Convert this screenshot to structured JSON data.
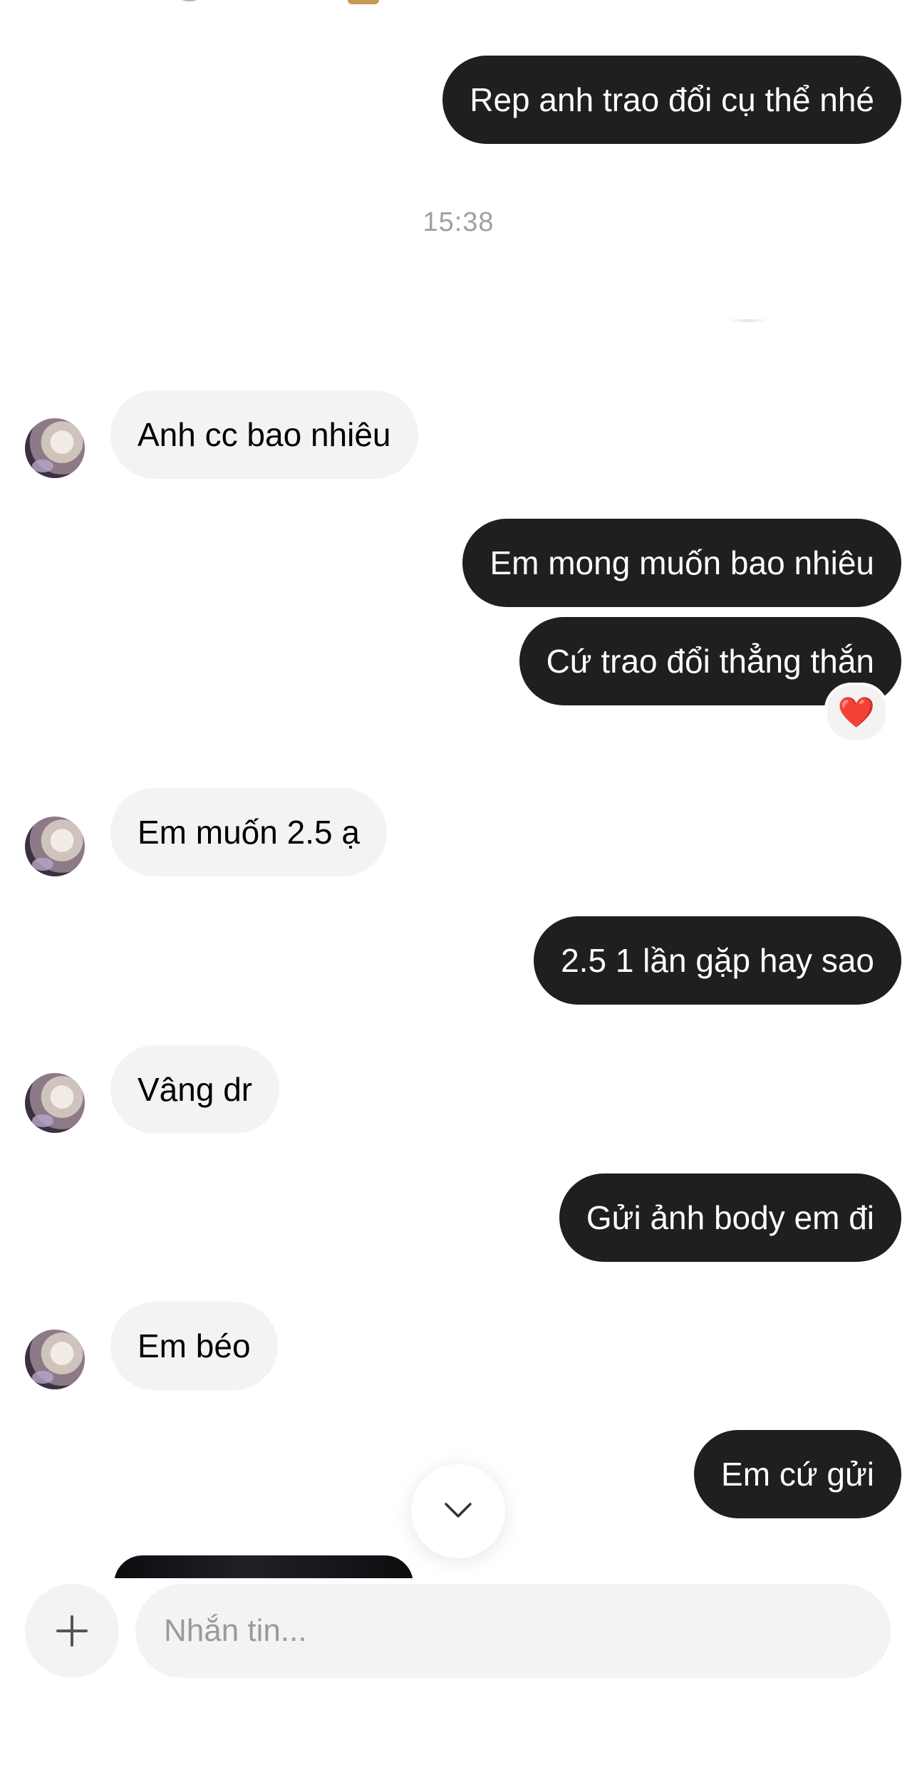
{
  "thread": {
    "messages": [
      {
        "dir": "out",
        "text": "Rep anh trao đổi cụ thể nhé"
      },
      {
        "dir": "in",
        "text": "Anh cc bao nhiêu"
      },
      {
        "dir": "out",
        "text": "Em mong muốn bao nhiêu"
      },
      {
        "dir": "out",
        "text": "Cứ trao đổi thẳng thắn",
        "reaction": "heart"
      },
      {
        "dir": "in",
        "text": "Em muốn 2.5 ạ"
      },
      {
        "dir": "out",
        "text": "2.5 1 lần gặp hay sao"
      },
      {
        "dir": "in",
        "text": "Vâng dr"
      },
      {
        "dir": "out",
        "text": "Gửi ảnh body em đi"
      },
      {
        "dir": "in",
        "text": "Em béo"
      },
      {
        "dir": "out",
        "text": "Em cứ gửi"
      }
    ],
    "timestamp": "15:38",
    "reaction_glyph": "❤️"
  },
  "composer": {
    "placeholder": "Nhắn tin...",
    "plus_icon": "plus-icon"
  },
  "scroll_button_icon": "chevron-down-icon",
  "colors": {
    "outgoing_bubble": "#1f1f1f",
    "incoming_bubble": "#f3f3f3",
    "timestamp": "#a0a0a0",
    "placeholder": "#9a9a9a",
    "reaction_heart": "#e0262d"
  }
}
